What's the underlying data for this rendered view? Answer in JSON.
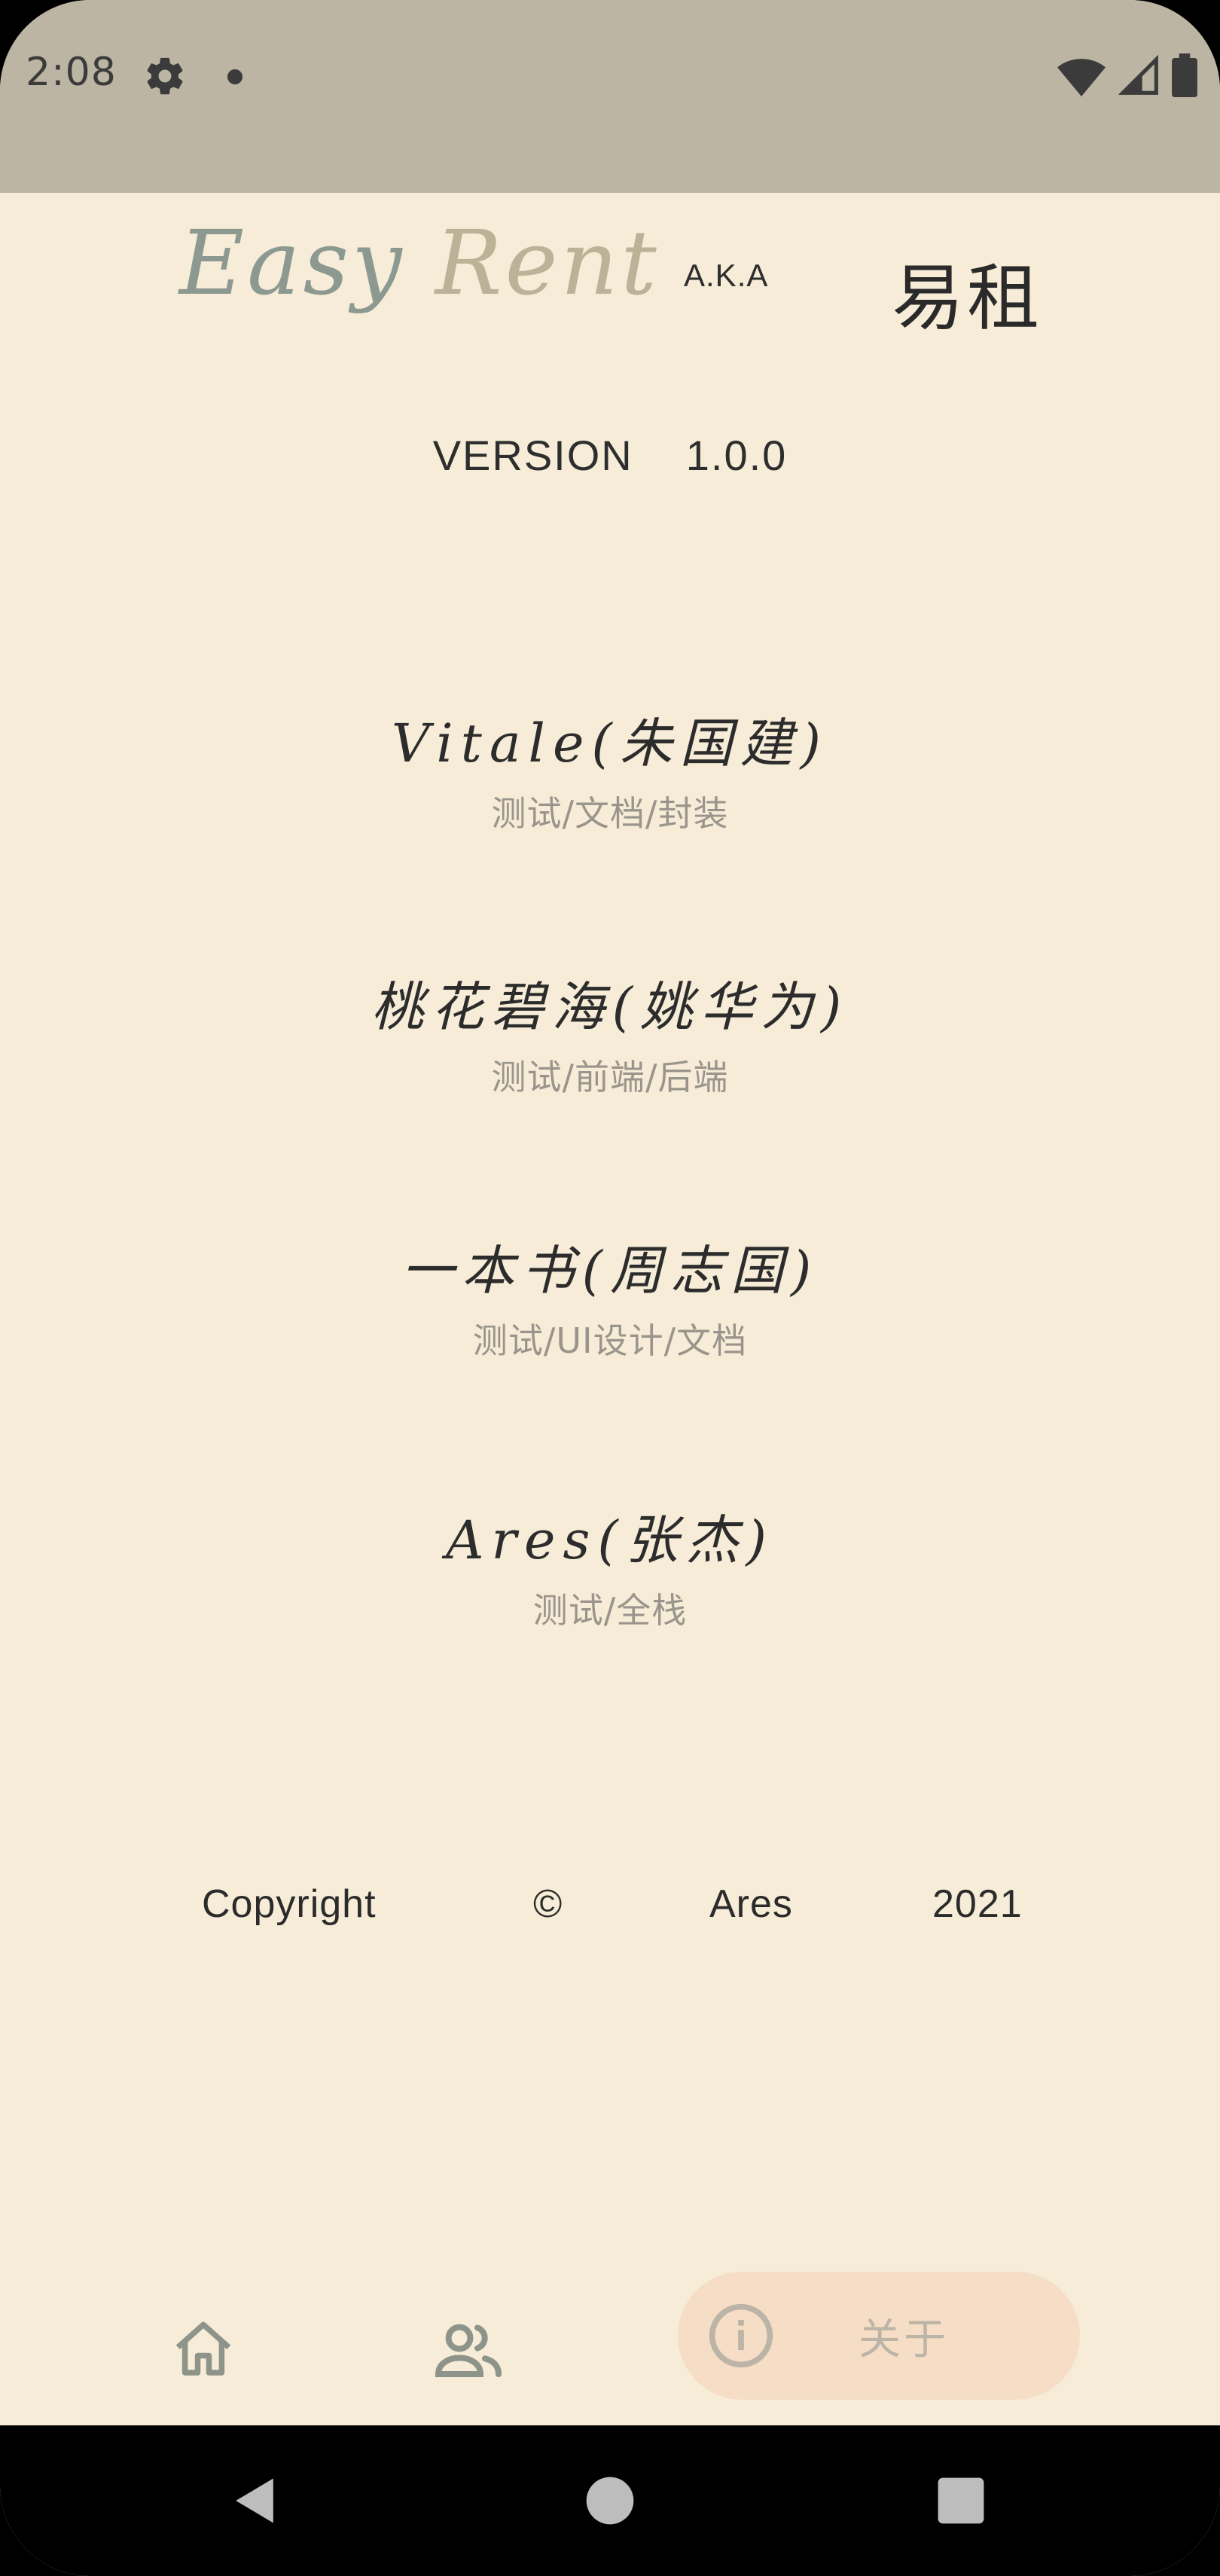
{
  "status_bar": {
    "time": "2:08",
    "icons": [
      "gear-icon",
      "notification-dot-icon",
      "wifi-icon",
      "signal-icon",
      "battery-icon"
    ]
  },
  "header": {
    "brand_word1": "Easy",
    "brand_word2": "Rent",
    "aka": "A.K.A",
    "chinese_name": "易租"
  },
  "version": {
    "label": "VERSION",
    "number": "1.0.0"
  },
  "members": [
    {
      "name": "Vitale(朱国建)",
      "role": "测试/文档/封装"
    },
    {
      "name": "桃花碧海(姚华为)",
      "role": "测试/前端/后端"
    },
    {
      "name": "一本书(周志国)",
      "role": "测试/UI设计/文档"
    },
    {
      "name": "Ares(张杰)",
      "role": "测试/全栈"
    }
  ],
  "copyright": {
    "word": "Copyright",
    "symbol": "©",
    "owner": "Ares",
    "year": "2021"
  },
  "bottom_nav": {
    "items": [
      {
        "icon": "home-icon",
        "label": ""
      },
      {
        "icon": "people-icon",
        "label": ""
      },
      {
        "icon": "info-icon",
        "label": "关于",
        "selected": true
      }
    ]
  },
  "system_nav": {
    "icons": [
      "back-icon",
      "home-circle-icon",
      "recents-icon"
    ]
  },
  "colors": {
    "background": "#f6ecd7",
    "status_bar": "#bcb5a3",
    "nav_active_pill": "#f5dec5",
    "icon_grey": "#8e948a",
    "secondary_text": "#9a958c"
  }
}
